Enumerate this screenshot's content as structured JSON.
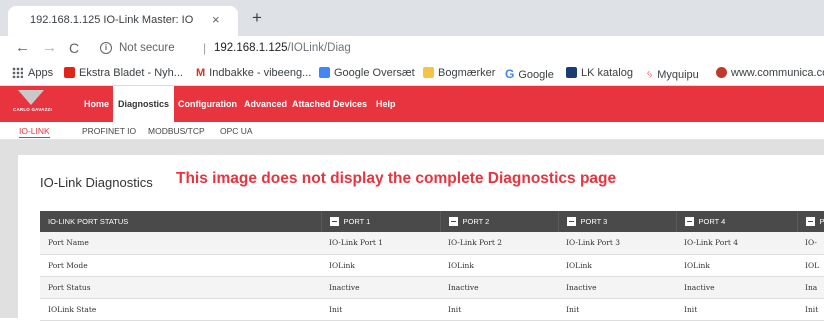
{
  "browser": {
    "tab_title": "192.168.1.125 IO-Link Master: IO",
    "tab_close": "×",
    "new_tab": "+",
    "nav": {
      "back": "←",
      "forward": "→",
      "reload": "C"
    },
    "security_label": "Not secure",
    "url_host": "192.168.1.125",
    "url_path": "/IOLink/Diag",
    "bookmarks": [
      {
        "label": "Apps",
        "icon": "apps-grid-icon"
      },
      {
        "label": "Ekstra Bladet - Nyh...",
        "icon": "ekstra-bladet-icon",
        "color": "#e2231a"
      },
      {
        "label": "Indbakke - vibeeng...",
        "icon": "gmail-icon",
        "color": "#d93025"
      },
      {
        "label": "Google Oversæt",
        "icon": "google-translate-icon",
        "color": "#4285f4"
      },
      {
        "label": "Bogmærker",
        "icon": "folder-icon",
        "color": "#f6c344"
      },
      {
        "label": "Google",
        "icon": "google-icon",
        "color": "#4285f4"
      },
      {
        "label": "LK katalog",
        "icon": "lk-icon",
        "color": "#1a3b73"
      },
      {
        "label": "Myquipu",
        "icon": "myquipu-icon",
        "color": "#e7343f"
      },
      {
        "label": "www.communica.co...",
        "icon": "communica-icon",
        "color": "#c0392b"
      }
    ]
  },
  "site": {
    "logo_text": "CARLO GAVAZZI",
    "menu": [
      "Home",
      "Diagnostics",
      "Configuration",
      "Advanced",
      "Attached Devices",
      "Help"
    ],
    "active_menu": "Diagnostics",
    "subnav": [
      "IO-LINK",
      "PROFINET IO",
      "MODBUS/TCP",
      "OPC UA"
    ],
    "active_subnav": "IO-LINK",
    "accent": "#e7343f"
  },
  "page": {
    "title": "IO-Link Diagnostics",
    "annotation": "This image does not display the complete Diagnostics page"
  },
  "table": {
    "headers": [
      "IO-LINK PORT STATUS",
      "PORT 1",
      "PORT 2",
      "PORT 3",
      "PORT 4",
      "P"
    ],
    "rows": [
      [
        "Port Name",
        "IO-Link Port 1",
        "IO-Link Port 2",
        "IO-Link Port 3",
        "IO-Link Port 4",
        "IO-"
      ],
      [
        "Port Mode",
        "IOLink",
        "IOLink",
        "IOLink",
        "IOLink",
        "IOL"
      ],
      [
        "Port Status",
        "Inactive",
        "Inactive",
        "Inactive",
        "Inactive",
        "Ina"
      ],
      [
        "IOLink State",
        "Init",
        "Init",
        "Init",
        "Init",
        "Init"
      ]
    ]
  }
}
